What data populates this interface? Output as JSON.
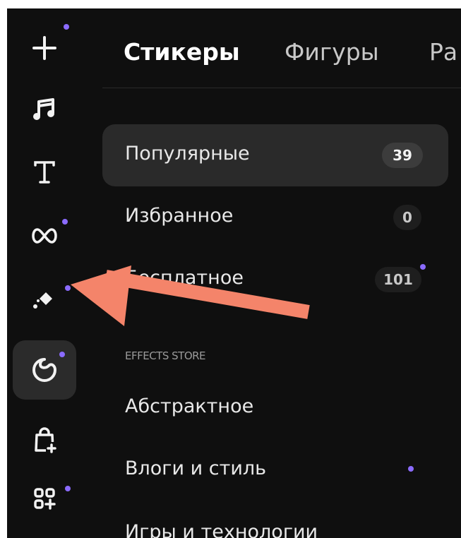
{
  "rail": {
    "items": [
      {
        "name": "add",
        "icon": "plus-icon",
        "dot": true
      },
      {
        "name": "audio",
        "icon": "music-note-icon",
        "dot": false
      },
      {
        "name": "text",
        "icon": "text-t-icon",
        "dot": false
      },
      {
        "name": "transitions",
        "icon": "bowtie-transition-icon",
        "dot": true
      },
      {
        "name": "effects",
        "icon": "sparkle-diamond-icon",
        "dot": true
      },
      {
        "name": "stickers",
        "icon": "sticker-icon",
        "dot": true,
        "active": true
      },
      {
        "name": "store",
        "icon": "shopping-bag-plus-icon",
        "dot": false
      },
      {
        "name": "apps",
        "icon": "apps-grid-plus-icon",
        "dot": true
      }
    ]
  },
  "tabs": [
    {
      "label": "Стикеры",
      "active": true
    },
    {
      "label": "Фигуры",
      "active": false
    },
    {
      "label": "Ра",
      "active": false
    }
  ],
  "categories": [
    {
      "label": "Популярные",
      "count": "39",
      "active": true
    },
    {
      "label": "Избранное",
      "count": "0"
    },
    {
      "label": "Бесплатное",
      "count": "101",
      "dot": true
    }
  ],
  "store": {
    "section_title": "EFFECTS STORE",
    "items": [
      {
        "label": "Абстрактное"
      },
      {
        "label": "Влоги и стиль",
        "dot": true
      },
      {
        "label": "Игры и технологии"
      }
    ]
  },
  "colors": {
    "background": "#0f0f0f",
    "active_item": "#2a2a2a",
    "accent_dot": "#8b6bff",
    "annotation_arrow": "#f4846a"
  }
}
